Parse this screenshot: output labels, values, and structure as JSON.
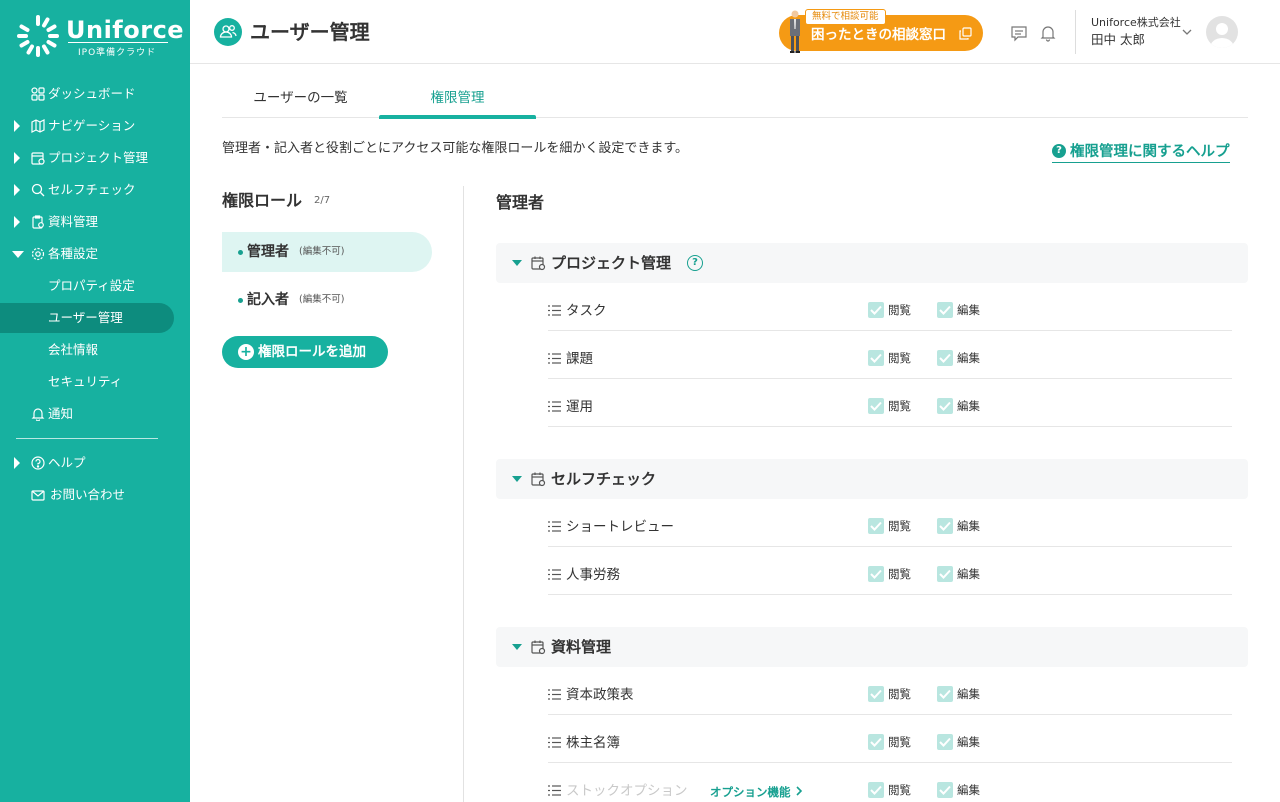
{
  "brand": {
    "name": "Uniforce",
    "tagline": "IPO準備クラウド"
  },
  "sidebar": {
    "items": [
      {
        "label": "ダッシュボード"
      },
      {
        "label": "ナビゲーション"
      },
      {
        "label": "プロジェクト管理"
      },
      {
        "label": "セルフチェック"
      },
      {
        "label": "資料管理"
      },
      {
        "label": "各種設定"
      },
      {
        "label": "プロパティ設定"
      },
      {
        "label": "ユーザー管理"
      },
      {
        "label": "会社情報"
      },
      {
        "label": "セキュリティ"
      },
      {
        "label": "通知"
      },
      {
        "label": "ヘルプ"
      },
      {
        "label": "お問い合わせ"
      }
    ]
  },
  "header": {
    "title": "ユーザー管理",
    "consult_badge": "無料で相談可能",
    "consult_label": "困ったときの相談窓口",
    "company": "Uniforce株式会社",
    "user": "田中 太郎"
  },
  "tabs": [
    {
      "label": "ユーザーの一覧"
    },
    {
      "label": "権限管理"
    }
  ],
  "description": "管理者・記入者と役割ごとにアクセス可能な権限ロールを細かく設定できます。",
  "help_link": "権限管理に関するヘルプ",
  "roles": {
    "title": "権限ロール",
    "count": "2/7",
    "items": [
      {
        "name": "管理者",
        "note": "(編集不可)"
      },
      {
        "name": "記入者",
        "note": "(編集不可)"
      }
    ],
    "add_label": "権限ロールを追加"
  },
  "permissions": {
    "title": "管理者",
    "view_label": "閲覧",
    "edit_label": "編集",
    "sections": [
      {
        "name": "プロジェクト管理",
        "rows": [
          "タスク",
          "課題",
          "運用"
        ]
      },
      {
        "name": "セルフチェック",
        "rows": [
          "ショートレビュー",
          "人事労務"
        ]
      },
      {
        "name": "資料管理",
        "rows": [
          "資本政策表",
          "株主名簿",
          "ストックオプション"
        ],
        "option_label": "オプション機能"
      }
    ]
  },
  "colors": {
    "primary": "#17b1a0",
    "accent": "#f59a14",
    "active_bg": "#def5f2"
  }
}
